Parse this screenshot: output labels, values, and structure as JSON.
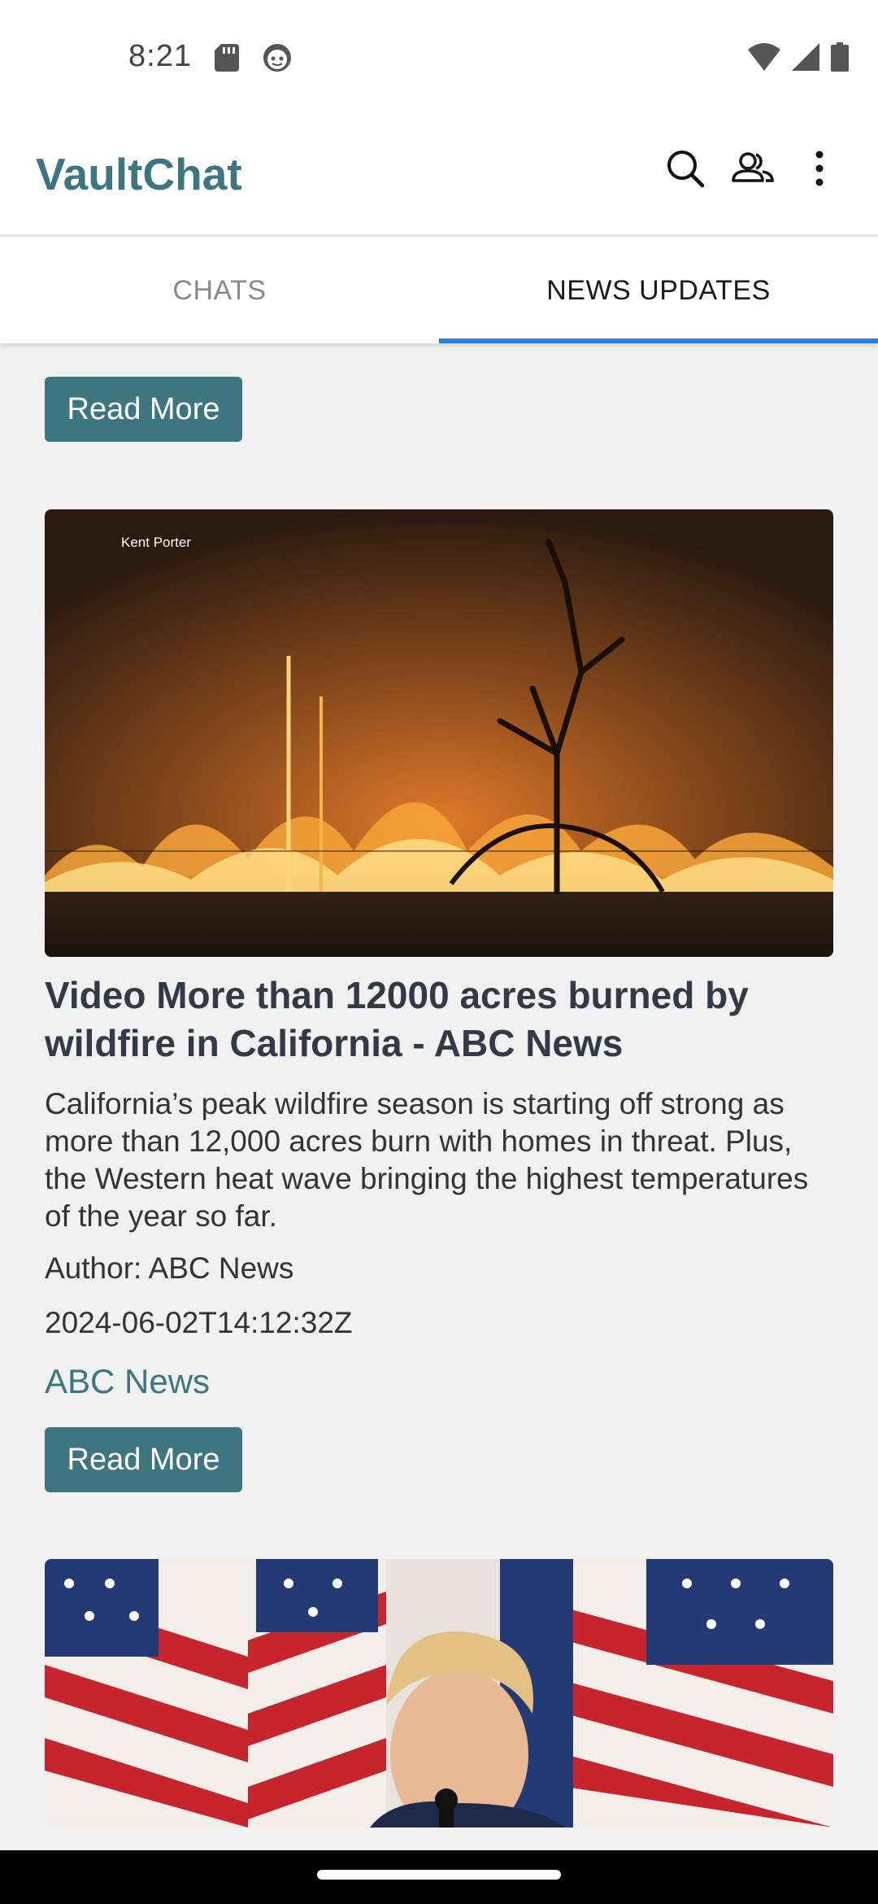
{
  "status_bar": {
    "time": "8:21",
    "icons": [
      "sd-card-icon",
      "face-icon",
      "wifi-icon",
      "signal-icon",
      "battery-icon"
    ]
  },
  "app_bar": {
    "title": "VaultChat",
    "title_color": "#3d7680",
    "actions": [
      "search-icon",
      "contacts-icon",
      "more-vert-icon"
    ]
  },
  "tabs": [
    {
      "label": "CHATS",
      "selected": false
    },
    {
      "label": "NEWS UPDATES",
      "selected": true
    }
  ],
  "accent_color": "#2b7fe0",
  "feed": {
    "read_more_label": "Read More",
    "articles": [
      {
        "image_credit": "Kent Porter",
        "title": "Video More than 12000 acres burned by wildfire in California - ABC News",
        "description": "California’s peak wildfire season is starting off strong as more than 12,000 acres burn with homes in threat. Plus, the Western heat wave bringing the highest temperatures of the year so far.",
        "author": "Author: ABC News",
        "published": "2024-06-02T14:12:32Z",
        "source": "ABC News",
        "button": "Read More"
      }
    ]
  }
}
